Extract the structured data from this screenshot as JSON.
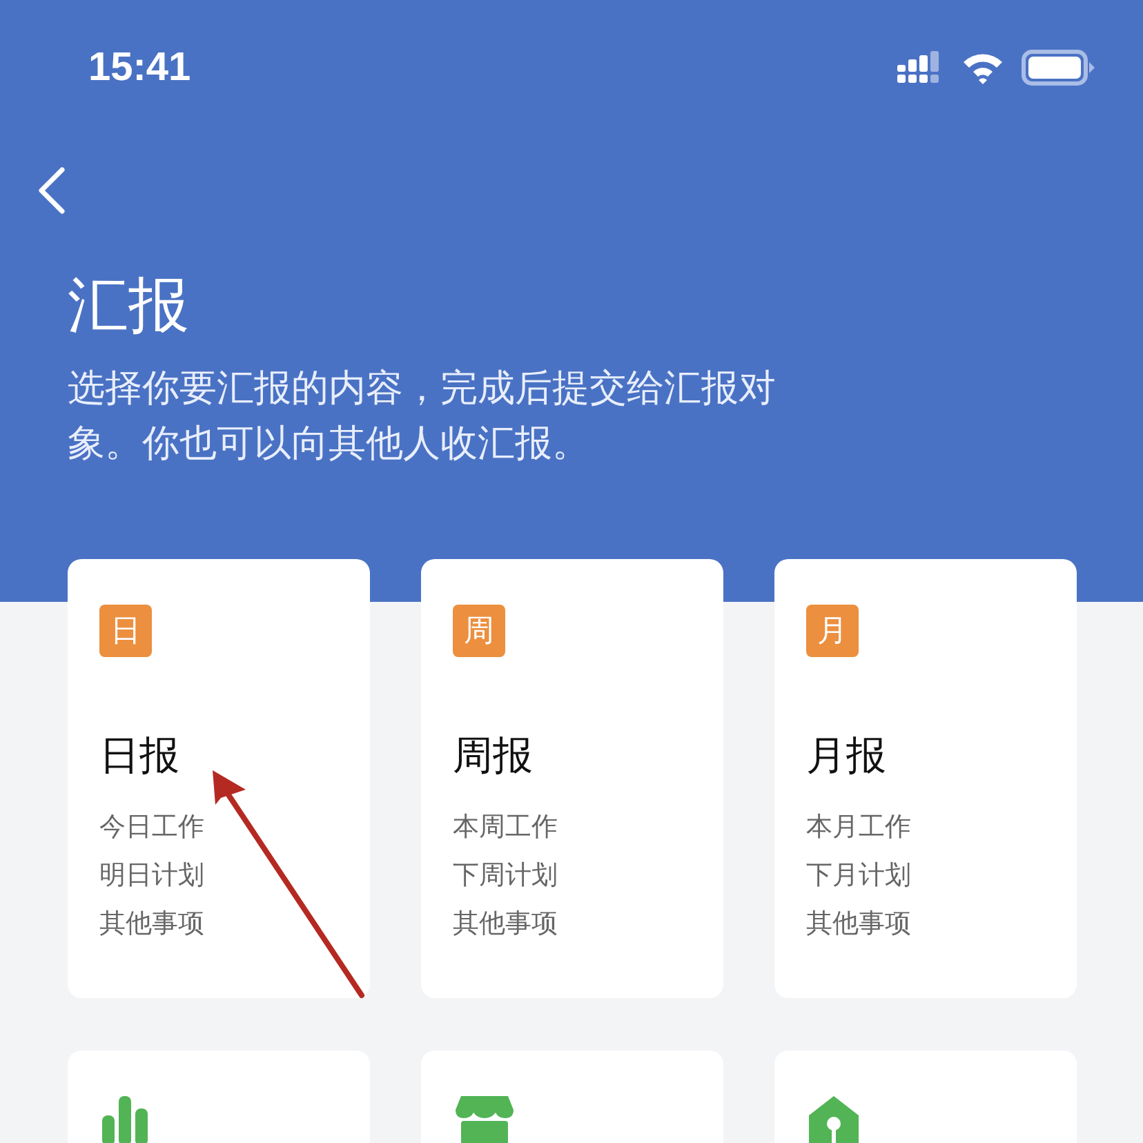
{
  "status_bar": {
    "time": "15:41"
  },
  "header": {
    "title": "汇报",
    "description": "选择你要汇报的内容，完成后提交给汇报对象。你也可以向其他人收汇报。"
  },
  "cards": [
    {
      "badge": "日",
      "title": "日报",
      "lines": [
        "今日工作",
        "明日计划",
        "其他事项"
      ]
    },
    {
      "badge": "周",
      "title": "周报",
      "lines": [
        "本周工作",
        "下周计划",
        "其他事项"
      ]
    },
    {
      "badge": "月",
      "title": "月报",
      "lines": [
        "本月工作",
        "下月计划",
        "其他事项"
      ]
    },
    {
      "kind": "chart"
    },
    {
      "kind": "shop"
    },
    {
      "kind": "house"
    }
  ],
  "annotation": {
    "kind": "arrow"
  }
}
